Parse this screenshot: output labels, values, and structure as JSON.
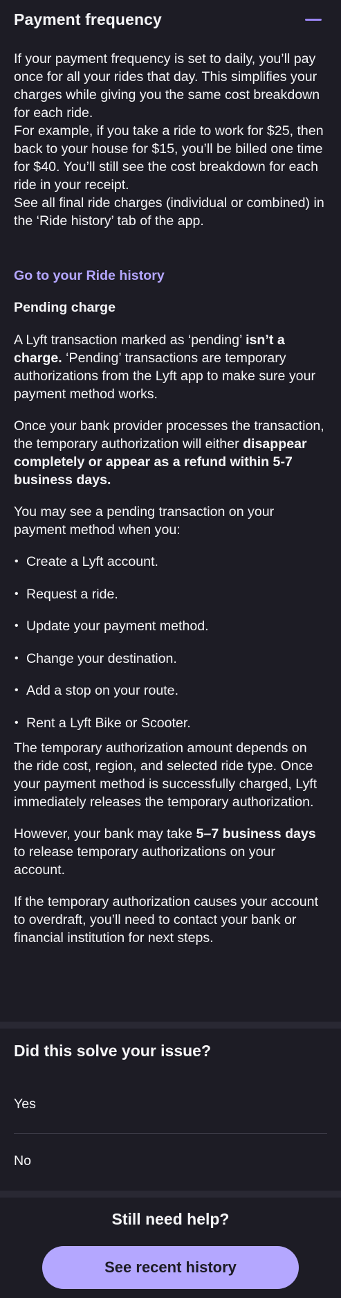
{
  "section": {
    "title": "Payment frequency"
  },
  "paragraphs": {
    "daily": "If your payment frequency is set to daily, you’ll pay once for all your rides that day. This simplifies your charges while giving you the same cost breakdown for each ride.",
    "example": "For example, if you take a ride to work for $25, then back to your house for $15, you’ll be billed one time for $40. You’ll still see the cost breakdown for each ride in your receipt.",
    "see_all": "See all final ride charges (individual or combined) in the ‘Ride history’ tab of the app."
  },
  "link": {
    "ride_history": "Go to your Ride history"
  },
  "pending": {
    "heading": "Pending charge",
    "p1_pre": "A Lyft transaction marked as ‘pending’ ",
    "p1_bold": "isn’t a charge.",
    "p1_post": " ‘Pending’ transactions are temporary authorizations from the Lyft app to make sure your payment method works.",
    "p2_pre": "Once your bank provider processes the transaction, the temporary authorization will either ",
    "p2_bold": "disappear completely or appear as a refund within 5-7 business days.",
    "p3": "You may see a pending transaction on your payment method when you:",
    "bullets": [
      "Create a Lyft account.",
      "Request a ride.",
      "Update your payment method.",
      "Change your destination.",
      "Add a stop on your route.",
      "Rent a Lyft Bike or Scooter."
    ],
    "p4": "The temporary authorization amount depends on the ride cost, region, and selected ride type. Once your payment method is successfully charged, Lyft immediately releases the temporary authorization.",
    "p5_pre": "However, your bank may take ",
    "p5_bold": "5–7 business days",
    "p5_post": " to release temporary authorizations on your account.",
    "p6": "If the temporary authorization causes your account to overdraft, you’ll need to contact your bank or financial institution for next steps."
  },
  "feedback": {
    "title": "Did this solve your issue?",
    "yes": "Yes",
    "no": "No"
  },
  "help": {
    "title": "Still need help?",
    "button": "See recent history"
  },
  "colors": {
    "background": "#1d1c25",
    "accent": "#b4a7ff",
    "link": "#b4a6ff"
  }
}
